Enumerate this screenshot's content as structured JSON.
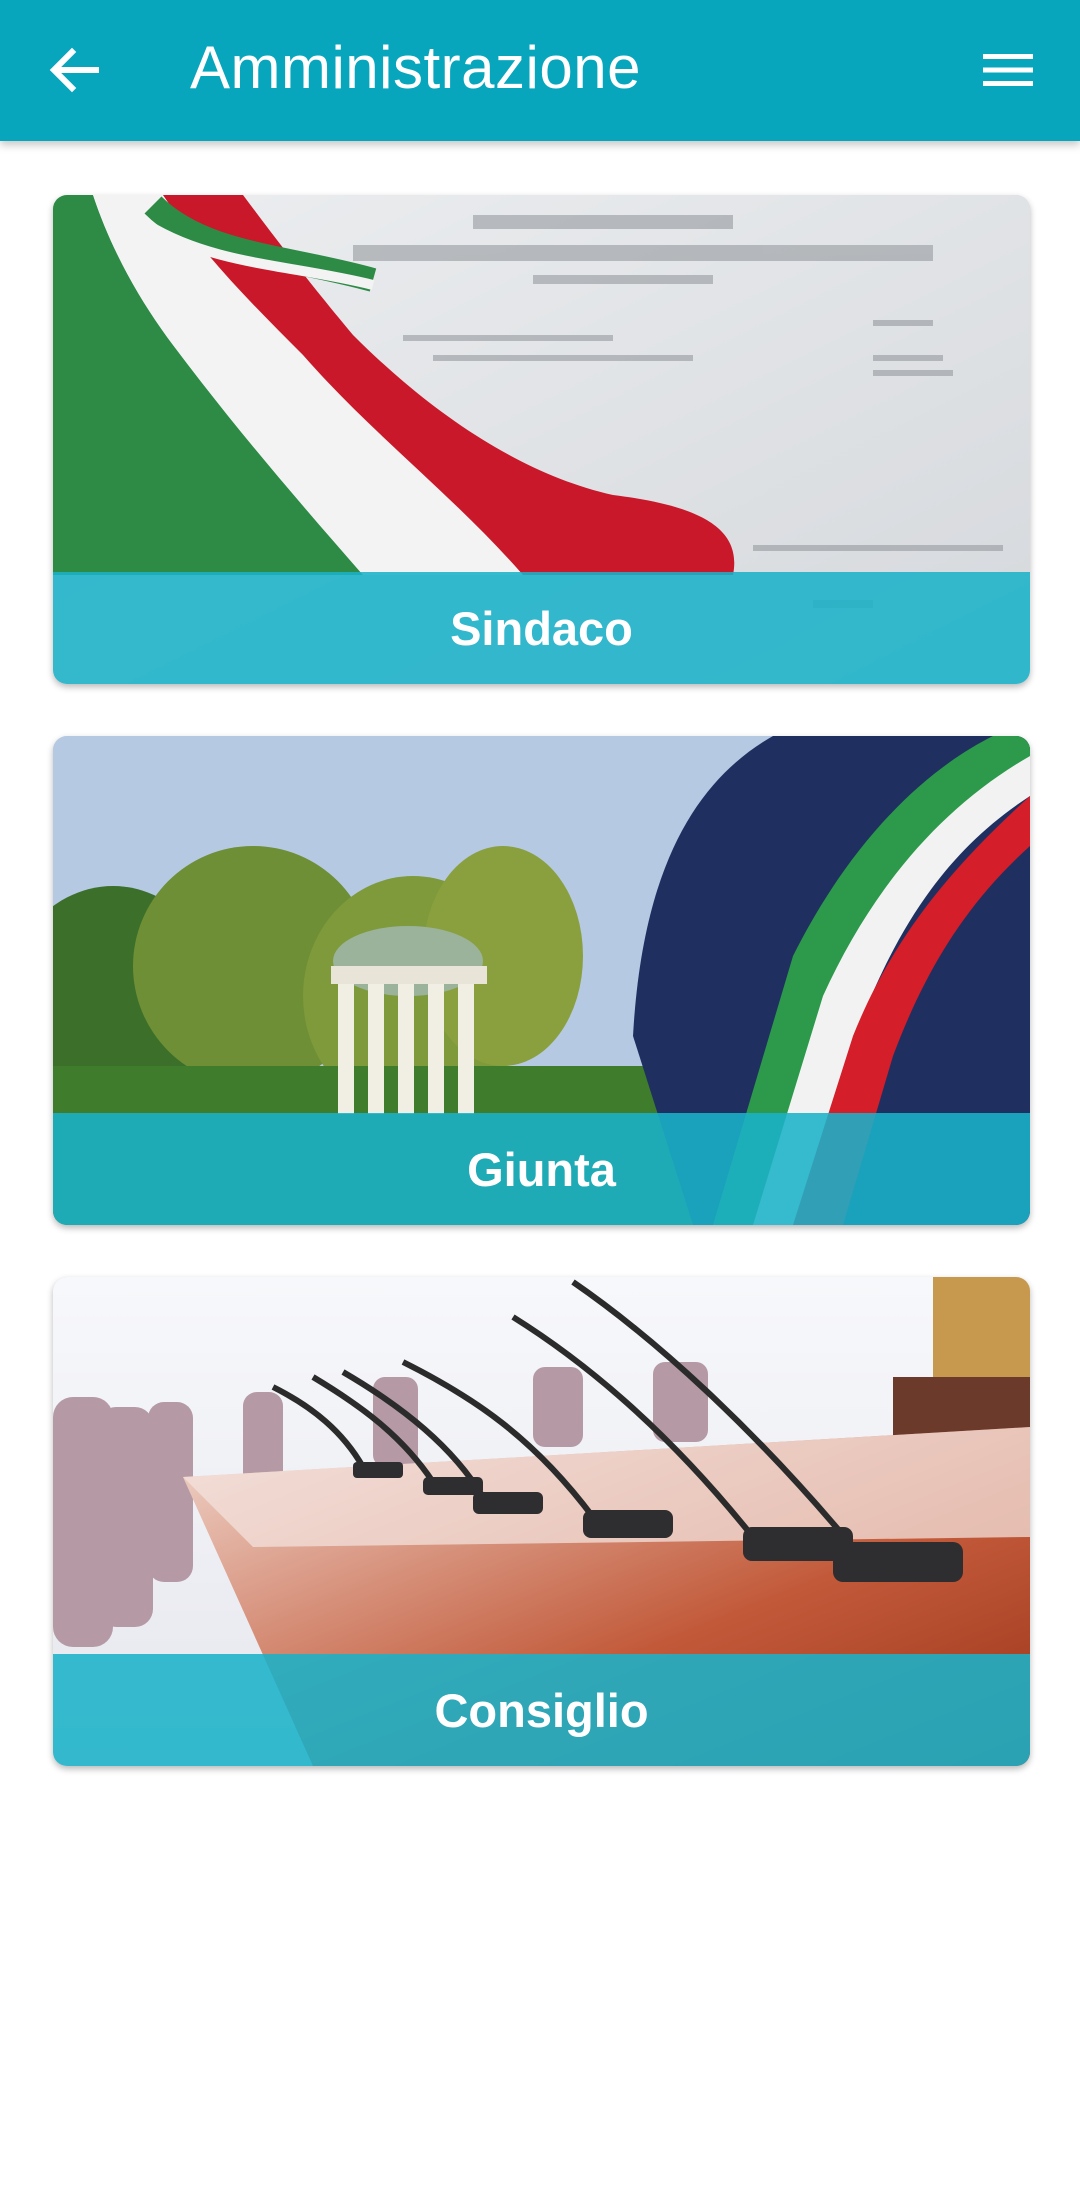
{
  "app_bar": {
    "title": "Amministrazione",
    "back_icon": "arrow-left-icon",
    "menu_icon": "hamburger-menu-icon",
    "background_color": "#07a6bd"
  },
  "cards": [
    {
      "label": "Sindaco"
    },
    {
      "label": "Giunta"
    },
    {
      "label": "Consiglio"
    }
  ],
  "colors": {
    "caption_overlay": "#1ab2c8",
    "text_on_primary": "#ffffff"
  }
}
